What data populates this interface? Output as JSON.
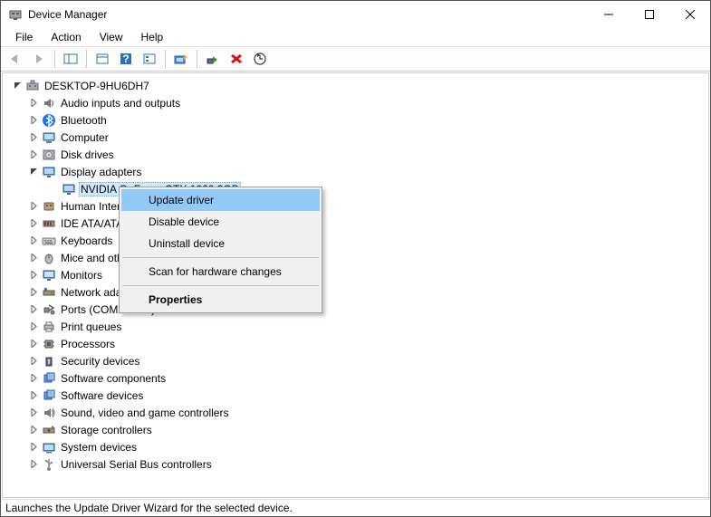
{
  "window": {
    "title": "Device Manager"
  },
  "menu": {
    "file": "File",
    "action": "Action",
    "view": "View",
    "help": "Help"
  },
  "tree": {
    "root": "DESKTOP-9HU6DH7",
    "items": [
      {
        "label": "Audio inputs and outputs",
        "icon": "audio"
      },
      {
        "label": "Bluetooth",
        "icon": "bluetooth"
      },
      {
        "label": "Computer",
        "icon": "computer"
      },
      {
        "label": "Disk drives",
        "icon": "disk"
      },
      {
        "label": "Display adapters",
        "icon": "display",
        "expanded": true,
        "children": [
          {
            "label": "NVIDIA GeForce GTX 1060 3GB",
            "icon": "display",
            "selected": true
          }
        ]
      },
      {
        "label": "Human Interface Devices",
        "icon": "hid"
      },
      {
        "label": "IDE ATA/ATAPI controllers",
        "icon": "ide"
      },
      {
        "label": "Keyboards",
        "icon": "keyboard"
      },
      {
        "label": "Mice and other pointing devices",
        "icon": "mouse"
      },
      {
        "label": "Monitors",
        "icon": "monitor"
      },
      {
        "label": "Network adapters",
        "icon": "network"
      },
      {
        "label": "Ports (COM & LPT)",
        "icon": "ports"
      },
      {
        "label": "Print queues",
        "icon": "printer"
      },
      {
        "label": "Processors",
        "icon": "cpu"
      },
      {
        "label": "Security devices",
        "icon": "security"
      },
      {
        "label": "Software components",
        "icon": "software"
      },
      {
        "label": "Software devices",
        "icon": "software"
      },
      {
        "label": "Sound, video and game controllers",
        "icon": "sound"
      },
      {
        "label": "Storage controllers",
        "icon": "storage"
      },
      {
        "label": "System devices",
        "icon": "system"
      },
      {
        "label": "Universal Serial Bus controllers",
        "icon": "usb"
      }
    ]
  },
  "context_menu": {
    "update": "Update driver",
    "disable": "Disable device",
    "uninstall": "Uninstall device",
    "scan": "Scan for hardware changes",
    "properties": "Properties"
  },
  "statusbar": "Launches the Update Driver Wizard for the selected device."
}
